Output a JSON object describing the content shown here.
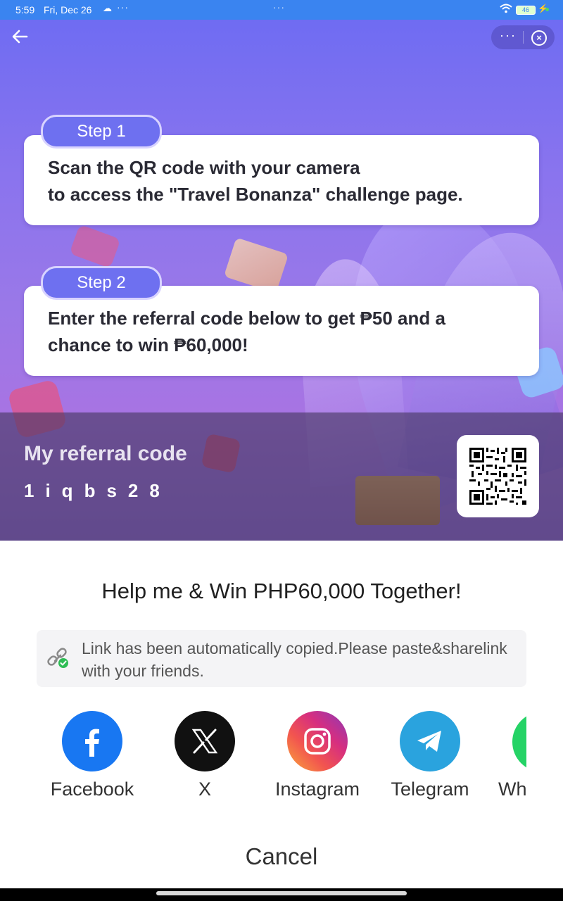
{
  "status_bar": {
    "time": "5:59",
    "date": "Fri, Dec 26",
    "battery": "46"
  },
  "steps": [
    {
      "pill": "Step 1",
      "text_line1": "Scan the QR code with your camera",
      "text_line2": "to access the \"Travel Bonanza\" challenge page."
    },
    {
      "pill": "Step 2",
      "text_line1": "Enter the referral code below to get ₱50 and a",
      "text_line2": "chance to win ₱60,000!"
    }
  ],
  "referral": {
    "title": "My referral code",
    "code": "1iqbs28"
  },
  "share_sheet": {
    "title": "Help me & Win PHP60,000 Together!",
    "notice_line1": "Link has been automatically copied.Please paste&sharelink",
    "notice_line2": "with your friends.",
    "apps": [
      {
        "name": "Facebook",
        "icon": "facebook-icon",
        "color": "#1877f2"
      },
      {
        "name": "X",
        "icon": "x-icon",
        "color": "#111111"
      },
      {
        "name": "Instagram",
        "icon": "instagram-icon",
        "color": "#e1306c"
      },
      {
        "name": "Telegram",
        "icon": "telegram-icon",
        "color": "#2aa3de"
      },
      {
        "name": "Wh",
        "icon": "whatsapp-icon",
        "color": "#25d366"
      }
    ],
    "cancel": "Cancel"
  }
}
